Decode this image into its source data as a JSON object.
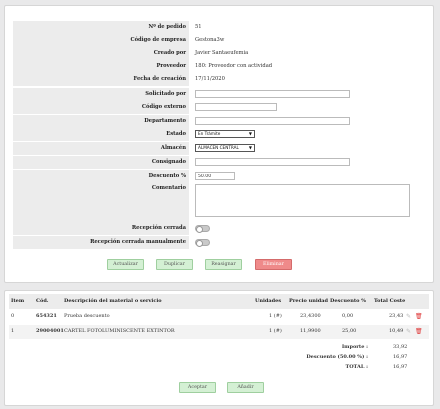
{
  "form": {
    "fields": [
      {
        "label": "Nº de pedido",
        "value": "51"
      },
      {
        "label": "Código de empresa",
        "value": "Gestona3w"
      },
      {
        "label": "Creado por",
        "value": "Javier Santaeufemia"
      },
      {
        "label": "Proveedor",
        "value": "180: Proveedor con actividad"
      },
      {
        "label": "Fecha de creación",
        "value": "17/11/2020"
      }
    ],
    "solicitado_label": "Solicitado por",
    "solicitado_value": "",
    "codigo_externo_label": "Código externo",
    "codigo_externo_value": "",
    "departamento_label": "Departamento",
    "departamento_value": "",
    "estado_label": "Estado",
    "estado_value": "En Trámite",
    "almacen_label": "Almacén",
    "almacen_value": "ALMACEN CENTRAL",
    "consignado_label": "Consignado",
    "consignado_value": "",
    "descuento_label": "Descuento %",
    "descuento_value": "50.00",
    "comentario_label": "Comentario",
    "comentario_value": "",
    "recepcion_cerrada_label": "Recepción cerrada",
    "recepcion_manual_label": "Recepción cerrada manualmente"
  },
  "actions": {
    "actualizar": "Actualizar",
    "duplicar": "Duplicar",
    "reasignar": "Reasignar",
    "eliminar": "Eliminar"
  },
  "items": {
    "headers": {
      "item": "Item",
      "cod": "Cód.",
      "desc": "Descripción del material o servicio",
      "unidades": "Unidades",
      "precio": "Precio unidad",
      "descuento": "Descuento %",
      "total": "Total Coste"
    },
    "rows": [
      {
        "item": "0",
        "cod": "654321",
        "desc": "Prueba descuento",
        "unidades": "1 (#)",
        "precio": "23,4300",
        "descuento": "0,00",
        "total": "23,43"
      },
      {
        "item": "1",
        "cod": "29004001",
        "desc": "CARTEL FOTOLUMINISCENTE EXTINTOR",
        "unidades": "1 (#)",
        "precio": "11,9900",
        "descuento": "25,00",
        "total": "10,49"
      }
    ],
    "summary": [
      {
        "label": "Importe :",
        "value": "33,92"
      },
      {
        "label": "Descuento (50.00 %) :",
        "value": "16,97"
      },
      {
        "label": "TOTAL :",
        "value": "16,97"
      }
    ],
    "aceptar": "Aceptar",
    "anadir": "Añadir"
  }
}
